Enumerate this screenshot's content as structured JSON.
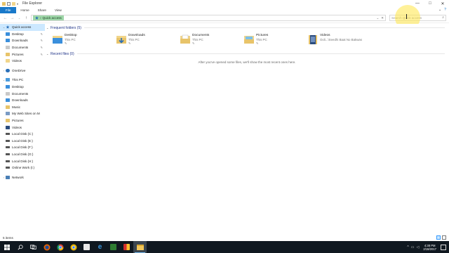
{
  "window": {
    "title": "File Explorer",
    "controls": {
      "minimize": "—",
      "maximize": "□",
      "close": "✕"
    }
  },
  "ribbon": {
    "tabs": [
      "File",
      "Home",
      "Share",
      "View"
    ]
  },
  "address": {
    "chip_label": "Quick access",
    "dropdown_glyph": "⌄",
    "refresh_glyph": "✕"
  },
  "search": {
    "placeholder": "Search Quick access"
  },
  "nav": {
    "quick_access": {
      "label": "Quick access",
      "items": [
        "Desktop",
        "Downloads",
        "Documents",
        "Pictures",
        "Videos"
      ]
    },
    "onedrive": "OneDrive",
    "this_pc": {
      "label": "This PC",
      "items": [
        "Desktop",
        "Documents",
        "Downloads",
        "Music",
        "My Web Sites on M",
        "Pictures",
        "Videos",
        "Local Disk (C:)",
        "Local Disk (E:)",
        "Local Disk (F:)",
        "Local Disk (G:)",
        "Local Disk (H:)",
        "Online Work (I:)"
      ]
    },
    "network": "Network"
  },
  "content": {
    "frequent": {
      "heading": "Frequent folders (5)",
      "tiles": [
        {
          "name": "Desktop",
          "sub": "This PC",
          "icon": "desktop-folder-icon",
          "color": "#3a8fdc"
        },
        {
          "name": "Downloads",
          "sub": "This PC",
          "icon": "downloads-folder-icon",
          "color": "#3a8fdc"
        },
        {
          "name": "Documents",
          "sub": "This PC",
          "icon": "documents-folder-icon",
          "color": "#e8c46a"
        },
        {
          "name": "Pictures",
          "sub": "This PC",
          "icon": "pictures-folder-icon",
          "color": "#e8c46a"
        },
        {
          "name": "Videos",
          "sub": "Ooli...\\Seedhi Baat No Bakwas",
          "icon": "videos-folder-icon",
          "color": "#2b4c7e"
        }
      ]
    },
    "recent": {
      "heading": "Recent files (0)",
      "empty_message": "After you've opened some files, we'll show the most recent ones here."
    }
  },
  "status": {
    "items_count": "5 items"
  },
  "taskbar": {
    "time": "4:38 PM",
    "date": "2/19/2017",
    "icons": [
      "windows-start-icon",
      "search-icon",
      "task-view-icon",
      "firefox-icon",
      "chrome-icon",
      "chrome-alt-icon",
      "app-icon",
      "edge-icon",
      "app-green-icon",
      "app-grid-icon",
      "file-explorer-icon"
    ]
  },
  "colors": {
    "accent": "#1979ca",
    "selected": "#cce8ff",
    "quick_access_chip": "#9ed7a8",
    "taskbar": "#101820"
  }
}
